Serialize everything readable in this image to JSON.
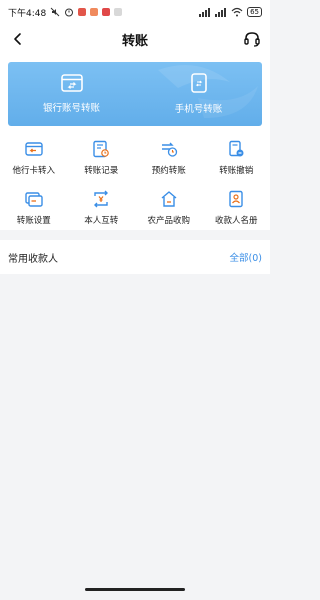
{
  "status_bar": {
    "time": "下午4:48",
    "battery": "65"
  },
  "header": {
    "title": "转账"
  },
  "hero": [
    {
      "label": "银行账号转账"
    },
    {
      "label": "手机号转账"
    }
  ],
  "features": [
    {
      "label": "他行卡转入"
    },
    {
      "label": "转账记录"
    },
    {
      "label": "预约转账"
    },
    {
      "label": "转账撤销"
    },
    {
      "label": "转账设置"
    },
    {
      "label": "本人互转"
    },
    {
      "label": "农产品收购"
    },
    {
      "label": "收款人名册"
    }
  ],
  "payees": {
    "title": "常用收款人",
    "all_label": "全部(0)"
  },
  "colors": {
    "accent": "#3a8ee6",
    "hero": "#6ab4ee",
    "orange": "#e9711c"
  }
}
